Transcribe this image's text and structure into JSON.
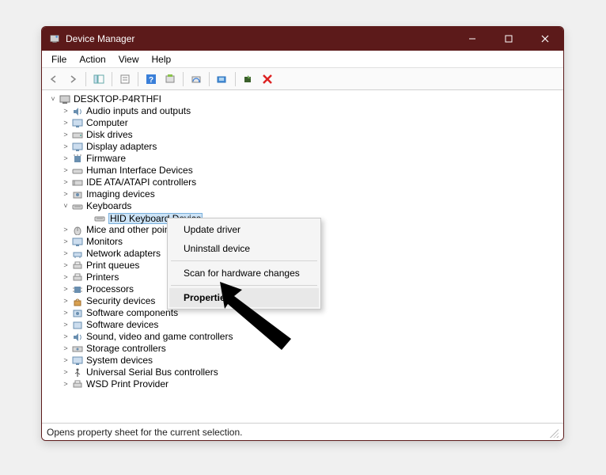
{
  "window": {
    "title": "Device Manager"
  },
  "menu": {
    "file": "File",
    "action": "Action",
    "view": "View",
    "help": "Help"
  },
  "tree": {
    "root": "DESKTOP-P4RTHFI",
    "nodes": {
      "audio": "Audio inputs and outputs",
      "computer": "Computer",
      "disk": "Disk drives",
      "display": "Display adapters",
      "firmware": "Firmware",
      "hid": "Human Interface Devices",
      "ide": "IDE ATA/ATAPI controllers",
      "imaging": "Imaging devices",
      "keyboards": "Keyboards",
      "hidkbd": "HID Keyboard Device",
      "mice": "Mice and other point",
      "monitors": "Monitors",
      "network": "Network adapters",
      "printqueues": "Print queues",
      "printers": "Printers",
      "processors": "Processors",
      "security": "Security devices",
      "swcomp": "Software components",
      "swdev": "Software devices",
      "sound": "Sound, video and game controllers",
      "storage": "Storage controllers",
      "sysdev": "System devices",
      "usb": "Universal Serial Bus controllers",
      "wsd": "WSD Print Provider"
    }
  },
  "context_menu": {
    "update": "Update driver",
    "uninstall": "Uninstall device",
    "scan": "Scan for hardware changes",
    "properties": "Properties"
  },
  "status": {
    "text": "Opens property sheet for the current selection."
  }
}
